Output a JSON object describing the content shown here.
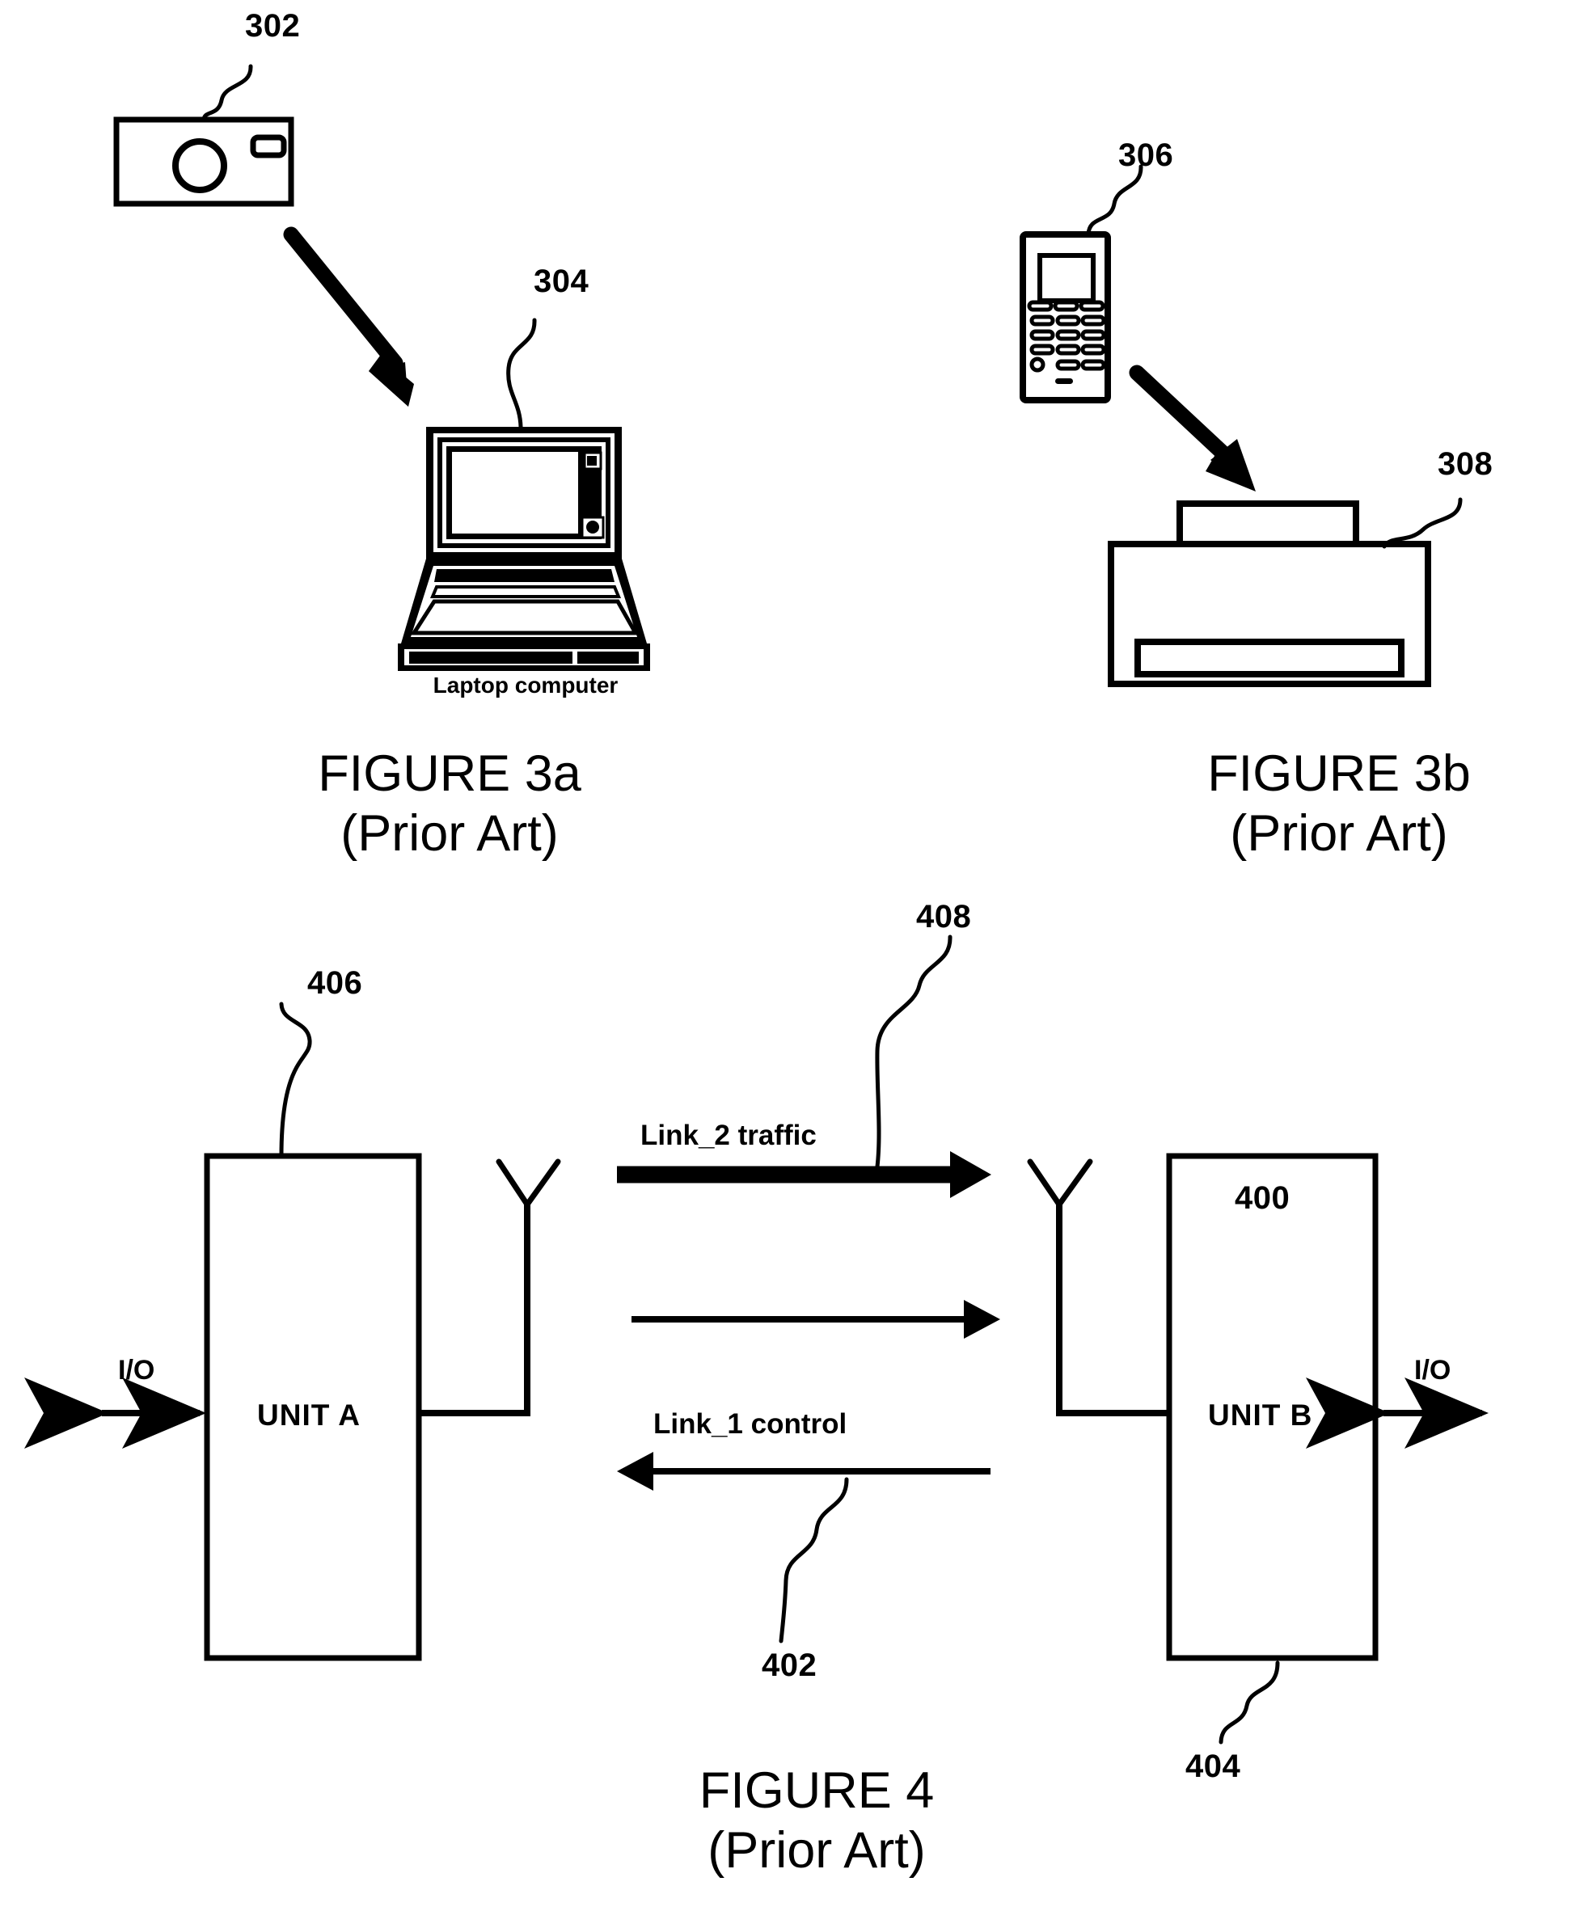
{
  "page": {
    "background_color": "#ffffff",
    "ink_color": "#000000"
  },
  "figures": [
    {
      "id": "figure-3a",
      "caption_line1": "FIGURE 3a",
      "caption_line2": "(Prior Art)",
      "device_caption": "Laptop computer",
      "ref_numbers": [
        {
          "name": "camera",
          "value": "302"
        },
        {
          "name": "laptop",
          "value": "304"
        }
      ],
      "icons": [
        {
          "name": "digital-camera-icon",
          "ref": "302"
        },
        {
          "name": "laptop-computer-icon",
          "ref": "304"
        },
        {
          "name": "transfer-arrow-icon",
          "ref": ""
        }
      ]
    },
    {
      "id": "figure-3b",
      "caption_line1": "FIGURE 3b",
      "caption_line2": "(Prior Art)",
      "ref_numbers": [
        {
          "name": "mobile-phone",
          "value": "306"
        },
        {
          "name": "printer",
          "value": "308"
        }
      ],
      "icons": [
        {
          "name": "mobile-phone-icon",
          "ref": "306"
        },
        {
          "name": "printer-icon",
          "ref": "308"
        },
        {
          "name": "transfer-arrow-icon",
          "ref": ""
        }
      ]
    },
    {
      "id": "figure-4",
      "caption_line1": "FIGURE 4",
      "caption_line2": "(Prior Art)",
      "system_ref": "400",
      "ref_numbers": [
        {
          "name": "system",
          "value": "400"
        },
        {
          "name": "link-1-control",
          "value": "402"
        },
        {
          "name": "unit-b",
          "value": "404"
        },
        {
          "name": "unit-a",
          "value": "406"
        },
        {
          "name": "link-2-traffic",
          "value": "408"
        }
      ],
      "units": [
        {
          "name": "unit-a",
          "label": "UNIT A",
          "ref": "406",
          "io_label": "I/O"
        },
        {
          "name": "unit-b",
          "label": "UNIT B",
          "ref": "404",
          "io_label": "I/O"
        }
      ],
      "links": [
        {
          "name": "link-2-traffic",
          "label": "Link_2 traffic",
          "ref": "408",
          "direction": "right",
          "weight": "thick"
        },
        {
          "name": "link-unlabeled-right",
          "label": "",
          "ref": "",
          "direction": "right",
          "weight": "thin"
        },
        {
          "name": "link-1-control",
          "label": "Link_1 control",
          "ref": "402",
          "direction": "left",
          "weight": "thin"
        }
      ],
      "icons": [
        {
          "name": "antenna-icon",
          "ref": "unit-a"
        },
        {
          "name": "antenna-icon",
          "ref": "unit-b"
        },
        {
          "name": "io-double-arrow-icon",
          "ref": "unit-a"
        },
        {
          "name": "io-double-arrow-icon",
          "ref": "unit-b"
        },
        {
          "name": "system-pointer-arrow-icon",
          "ref": "400"
        }
      ]
    }
  ]
}
